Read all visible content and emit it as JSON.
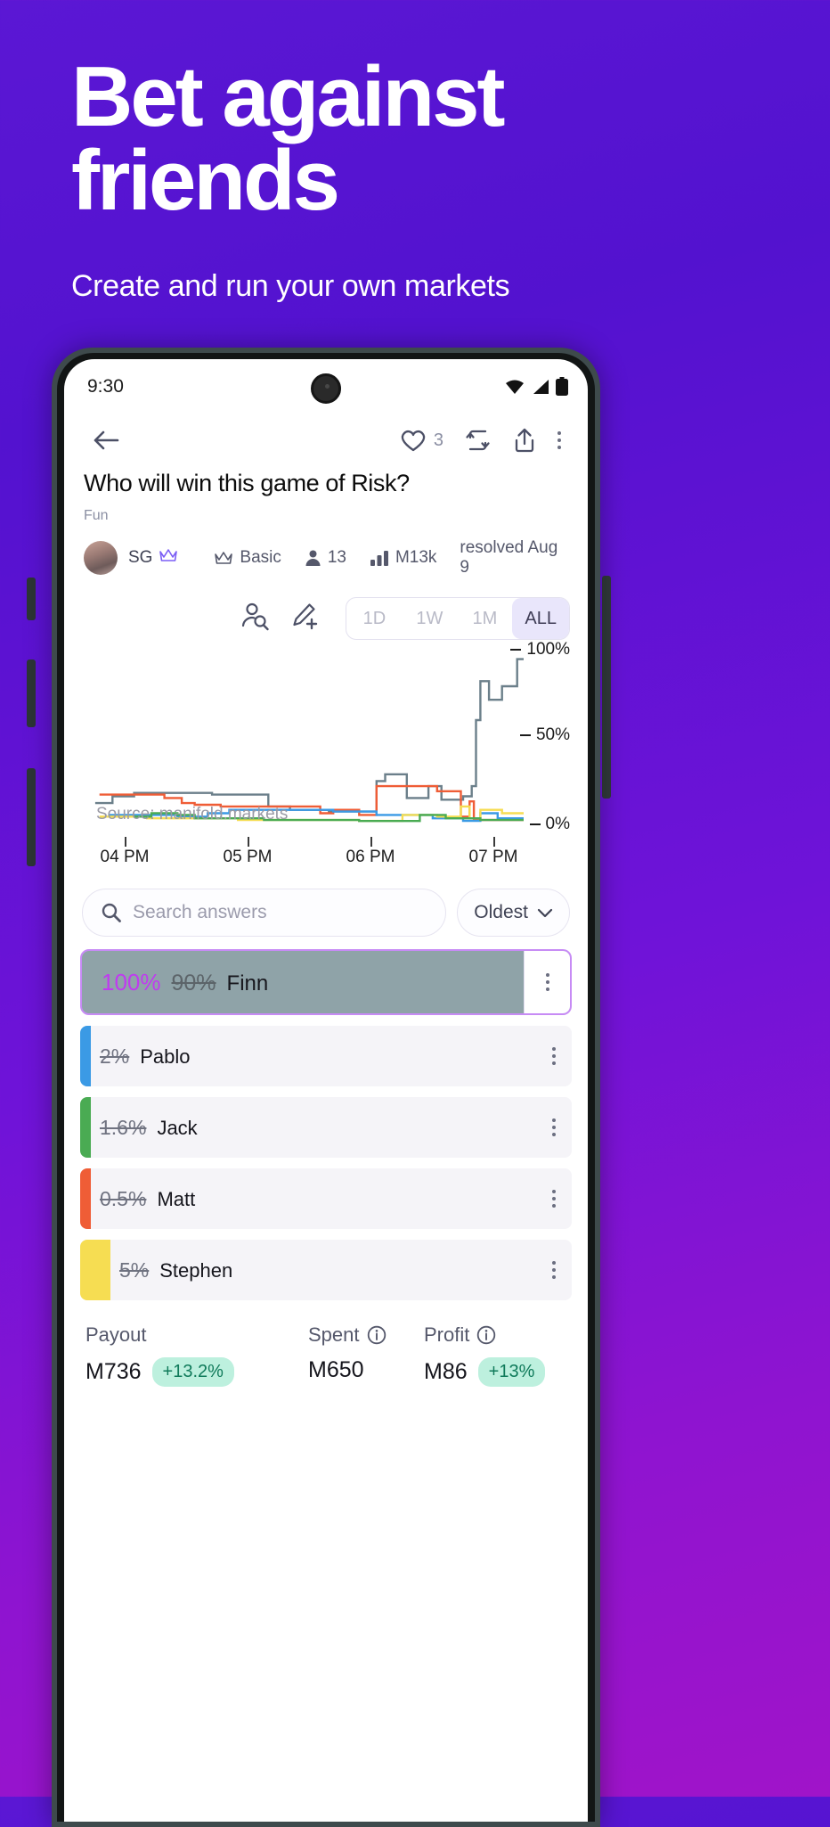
{
  "hero": {
    "title_line1": "Bet against",
    "title_line2": "friends",
    "subtitle": "Create and run your own markets"
  },
  "status_bar": {
    "clock": "9:30",
    "icons": [
      "wifi-icon",
      "cellular-signal-icon",
      "battery-icon"
    ]
  },
  "toolbar": {
    "back_icon": "back-arrow-icon",
    "like_icon": "heart-icon",
    "like_count": "3",
    "repost_icon": "repost-icon",
    "share_icon": "share-icon",
    "more_icon": "kebab-menu-icon"
  },
  "market": {
    "question": "Who will win this game of Risk?",
    "topic": "Fun",
    "author": "SG",
    "author_badge": "crown-icon",
    "tier_icon": "crown-icon",
    "tier": "Basic",
    "traders_icon": "person-icon",
    "traders": "13",
    "volume_icon": "bar-chart-icon",
    "volume": "M13k",
    "resolved": "resolved Aug 9"
  },
  "chart_controls": {
    "search_users_icon": "user-search-icon",
    "edit_icon": "edit-pencil-plus-icon",
    "ranges": [
      {
        "label": "1D",
        "active": false
      },
      {
        "label": "1W",
        "active": false
      },
      {
        "label": "1M",
        "active": false
      },
      {
        "label": "ALL",
        "active": true
      }
    ]
  },
  "chart_data": {
    "type": "line",
    "title": "",
    "xlabel": "",
    "ylabel": "",
    "ylim": [
      0,
      100
    ],
    "y_ticks": [
      "0%",
      "50%",
      "100%"
    ],
    "x_ticks": [
      "04 PM",
      "05 PM",
      "06 PM",
      "07 PM"
    ],
    "grid": false,
    "legend": "none",
    "source_note": "Source: manifold.markets",
    "series": [
      {
        "name": "Finn",
        "color": "#6b7f8a",
        "points": [
          [
            0.01,
            11
          ],
          [
            0.05,
            11
          ],
          [
            0.05,
            15
          ],
          [
            0.1,
            15
          ],
          [
            0.1,
            17
          ],
          [
            0.28,
            17
          ],
          [
            0.28,
            16
          ],
          [
            0.41,
            16
          ],
          [
            0.41,
            9
          ],
          [
            0.46,
            9
          ],
          [
            0.46,
            7
          ],
          [
            0.55,
            7
          ],
          [
            0.55,
            6
          ],
          [
            0.66,
            6
          ],
          [
            0.66,
            24
          ],
          [
            0.68,
            24
          ],
          [
            0.68,
            28
          ],
          [
            0.73,
            28
          ],
          [
            0.73,
            14
          ],
          [
            0.78,
            14
          ],
          [
            0.78,
            21
          ],
          [
            0.81,
            21
          ],
          [
            0.81,
            13
          ],
          [
            0.86,
            13
          ],
          [
            0.86,
            15
          ],
          [
            0.88,
            15
          ],
          [
            0.88,
            21
          ],
          [
            0.89,
            21
          ],
          [
            0.89,
            60
          ],
          [
            0.9,
            60
          ],
          [
            0.9,
            83
          ],
          [
            0.92,
            83
          ],
          [
            0.92,
            72
          ],
          [
            0.95,
            72
          ],
          [
            0.95,
            80
          ],
          [
            0.985,
            80
          ],
          [
            0.985,
            96
          ],
          [
            1.0,
            96
          ]
        ]
      },
      {
        "name": "Matt",
        "color": "#ef5d36",
        "points": [
          [
            0.02,
            16
          ],
          [
            0.17,
            16
          ],
          [
            0.17,
            14
          ],
          [
            0.21,
            14
          ],
          [
            0.21,
            11
          ],
          [
            0.24,
            11
          ],
          [
            0.24,
            10
          ],
          [
            0.3,
            10
          ],
          [
            0.3,
            9
          ],
          [
            0.53,
            9
          ],
          [
            0.53,
            5
          ],
          [
            0.56,
            5
          ],
          [
            0.56,
            7
          ],
          [
            0.62,
            7
          ],
          [
            0.62,
            4
          ],
          [
            0.66,
            4
          ],
          [
            0.66,
            21
          ],
          [
            0.8,
            21
          ],
          [
            0.8,
            18
          ],
          [
            0.855,
            18
          ],
          [
            0.855,
            3
          ],
          [
            0.875,
            3
          ],
          [
            0.875,
            12
          ],
          [
            0.885,
            12
          ],
          [
            0.885,
            1
          ],
          [
            1.0,
            1
          ]
        ]
      },
      {
        "name": "Pablo",
        "color": "#3b9ae5",
        "points": [
          [
            0.04,
            4
          ],
          [
            0.2,
            4
          ],
          [
            0.2,
            3
          ],
          [
            0.27,
            3
          ],
          [
            0.27,
            5
          ],
          [
            0.32,
            5
          ],
          [
            0.32,
            7
          ],
          [
            0.56,
            7
          ],
          [
            0.56,
            6
          ],
          [
            0.66,
            6
          ],
          [
            0.66,
            4
          ],
          [
            0.79,
            4
          ],
          [
            0.79,
            2
          ],
          [
            0.86,
            2
          ],
          [
            0.86,
            0.5
          ],
          [
            0.9,
            0.5
          ],
          [
            0.9,
            5
          ],
          [
            0.94,
            5
          ],
          [
            0.94,
            2
          ],
          [
            1.0,
            2
          ]
        ]
      },
      {
        "name": "Stephen",
        "color": "#f6dd52",
        "points": [
          [
            0.02,
            3
          ],
          [
            0.13,
            3
          ],
          [
            0.13,
            2
          ],
          [
            0.34,
            2
          ],
          [
            0.34,
            1
          ],
          [
            0.62,
            1
          ],
          [
            0.62,
            0.5
          ],
          [
            0.72,
            0.5
          ],
          [
            0.72,
            4
          ],
          [
            0.8,
            4
          ],
          [
            0.8,
            3
          ],
          [
            0.855,
            3
          ],
          [
            0.855,
            9
          ],
          [
            0.875,
            9
          ],
          [
            0.875,
            2
          ],
          [
            0.9,
            2
          ],
          [
            0.9,
            7
          ],
          [
            0.95,
            7
          ],
          [
            0.95,
            5
          ],
          [
            1.0,
            5
          ]
        ]
      },
      {
        "name": "Jack",
        "color": "#4aab53",
        "points": [
          [
            0.1,
            3
          ],
          [
            0.14,
            3
          ],
          [
            0.14,
            5
          ],
          [
            0.2,
            5
          ],
          [
            0.2,
            4
          ],
          [
            0.24,
            4
          ],
          [
            0.24,
            2
          ],
          [
            0.4,
            2
          ],
          [
            0.4,
            1
          ],
          [
            0.62,
            1
          ],
          [
            0.62,
            0.4
          ],
          [
            0.76,
            0.4
          ],
          [
            0.76,
            4
          ],
          [
            0.82,
            4
          ],
          [
            0.82,
            2
          ],
          [
            0.9,
            2
          ],
          [
            0.9,
            1
          ],
          [
            1.0,
            1
          ]
        ]
      }
    ]
  },
  "search": {
    "icon": "search-icon",
    "placeholder": "Search answers",
    "sort_label": "Oldest",
    "sort_icon": "chevron-down-icon"
  },
  "answers": [
    {
      "name": "Finn",
      "resolved_pct": "100%",
      "old_pct": "90%",
      "color": "#8fa3a8",
      "fill": 0.86,
      "winner": true,
      "menu_icon": "kebab-menu-icon"
    },
    {
      "name": "Pablo",
      "old_pct": "2%",
      "color": "#3b9ae5",
      "fill": 0.02,
      "winner": false,
      "menu_icon": "kebab-menu-icon"
    },
    {
      "name": "Jack",
      "old_pct": "1.6%",
      "color": "#4aab53",
      "fill": 0.016,
      "winner": false,
      "menu_icon": "kebab-menu-icon"
    },
    {
      "name": "Matt",
      "old_pct": "0.5%",
      "color": "#ef5d36",
      "fill": 0.005,
      "winner": false,
      "menu_icon": "kebab-menu-icon"
    },
    {
      "name": "Stephen",
      "old_pct": "5%",
      "color": "#f6dd52",
      "fill": 0.05,
      "winner": false,
      "menu_icon": "kebab-menu-icon"
    }
  ],
  "stats": {
    "payout": {
      "label": "Payout",
      "value": "M736",
      "chip": "+13.2%"
    },
    "spent": {
      "label": "Spent",
      "info_icon": "info-icon",
      "value": "M650"
    },
    "profit": {
      "label": "Profit",
      "info_icon": "info-icon",
      "value": "M86",
      "chip": "+13%"
    }
  },
  "colors": {
    "accent_purple": "#c03bf0",
    "chip_green_bg": "#bdf0de",
    "chip_green_fg": "#0f7a5a",
    "range_active_bg": "#e9e6fb"
  }
}
